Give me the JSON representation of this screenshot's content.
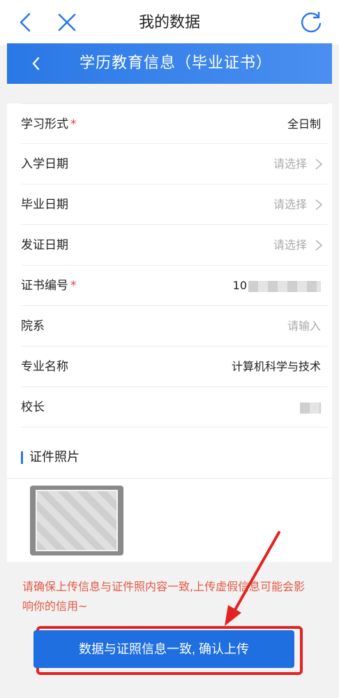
{
  "topbar": {
    "title": "我的数据"
  },
  "subheader": {
    "title": "学历教育信息（毕业证书）"
  },
  "form": {
    "rows": [
      {
        "label": "学习形式",
        "required": "*",
        "value": "全日制"
      },
      {
        "label": "入学日期",
        "value": "请选择"
      },
      {
        "label": "毕业日期",
        "value": "请选择"
      },
      {
        "label": "发证日期",
        "value": "请选择"
      },
      {
        "label": "证书编号",
        "required": "*",
        "value": "10"
      },
      {
        "label": "院系",
        "value": "请输入"
      },
      {
        "label": "专业名称",
        "value": "计算机科学与技术"
      },
      {
        "label": "校长",
        "value": ""
      }
    ]
  },
  "photos": {
    "section_title": "证件照片"
  },
  "notice": {
    "text": "请确保上传信息与证件照内容一致,上传虚假信息可能会影响你的信用~"
  },
  "confirm": {
    "label": "数据与证照信息一致, 确认上传"
  },
  "colors": {
    "accent": "#2a78e6",
    "warning": "#e05a47",
    "highlight": "#e32222"
  }
}
